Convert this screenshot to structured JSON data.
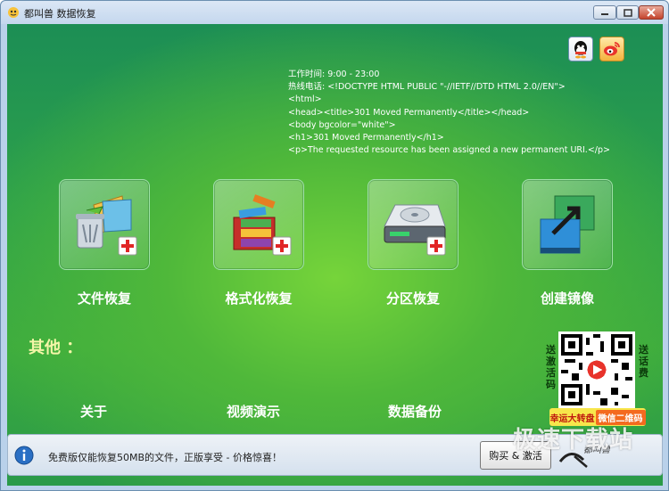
{
  "window": {
    "title": "都叫兽 数据恢复"
  },
  "notice": {
    "lines": [
      "工作时间: 9:00 - 23:00",
      "热线电话: <!DOCTYPE HTML PUBLIC \"-//IETF//DTD HTML 2.0//EN\">",
      "<html>",
      "<head><title>301 Moved Permanently</title></head>",
      "<body bgcolor=\"white\">",
      "<h1>301 Moved Permanently</h1>",
      "<p>The requested resource has been assigned a new permanent URI.</p>"
    ]
  },
  "features": [
    {
      "label": "文件恢复",
      "icon": "file-recovery-icon"
    },
    {
      "label": "格式化恢复",
      "icon": "format-recovery-icon"
    },
    {
      "label": "分区恢复",
      "icon": "partition-recovery-icon"
    },
    {
      "label": "创建镜像",
      "icon": "create-image-icon"
    }
  ],
  "other": {
    "title": "其他 ：",
    "links": [
      "关于",
      "视频演示",
      "数据备份"
    ]
  },
  "qr": {
    "left_text": "送激活码",
    "right_text": "送话费",
    "badge_left": "幸运大转盘",
    "badge_right": "微信二维码"
  },
  "bottom": {
    "promo": "免费版仅能恢复50MB的文件，正版享受 - 价格惊喜！",
    "buy_label": "购买 & 激活",
    "brand": "都叫兽"
  },
  "watermark": "极速下载站",
  "colors": {
    "accent_green": "#4fb83a",
    "other_title": "#f4f6a8",
    "close_red": "#c4432c"
  }
}
